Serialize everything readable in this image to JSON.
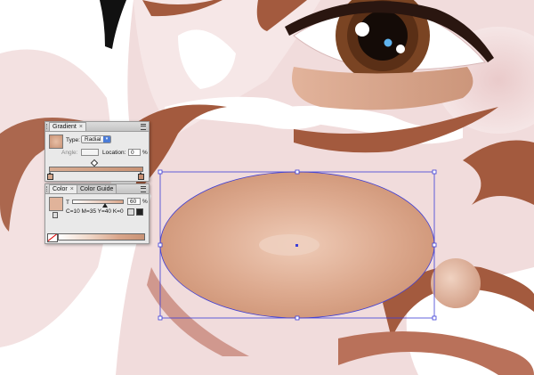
{
  "colors": {
    "skin": "#d9a68b",
    "stroke_brown": "#a35a3e",
    "pale_pink": "#e9d0cf",
    "iris": "#6b3a1f",
    "selection": "#3d3dd6"
  },
  "gradient_panel": {
    "tab_label": "Gradient",
    "close_glyph": "×",
    "type_label": "Type:",
    "type_value": "Radial",
    "angle_label": "Angle:",
    "angle_value": "",
    "location_label": "Location:",
    "location_value": "0",
    "percent": "%"
  },
  "color_panel": {
    "tab_color": "Color",
    "tab_color_guide": "Color Guide",
    "close_glyph": "×",
    "tint_label": "T",
    "tint_value": "60",
    "percent": "%",
    "cmyk_readout": "C=10 M=35 Y=40 K=0"
  }
}
